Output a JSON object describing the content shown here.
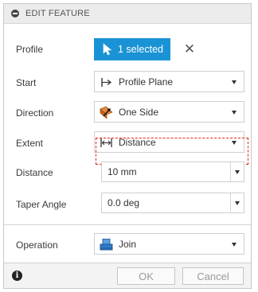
{
  "header": {
    "title": "EDIT FEATURE"
  },
  "rows": {
    "profile": {
      "label": "Profile",
      "button_text": "1 selected",
      "clear": "✕"
    },
    "start": {
      "label": "Start",
      "value": "Profile Plane"
    },
    "direction": {
      "label": "Direction",
      "value": "One Side"
    },
    "extent": {
      "label": "Extent",
      "value": "Distance"
    },
    "distance": {
      "label": "Distance",
      "value": "10 mm"
    },
    "taper": {
      "label": "Taper Angle",
      "value": "0.0 deg"
    },
    "operation": {
      "label": "Operation",
      "value": "Join"
    }
  },
  "footer": {
    "info": "i",
    "ok": "OK",
    "cancel": "Cancel"
  },
  "colors": {
    "accent": "#1a93d6",
    "highlight": "#e0201b"
  },
  "icons": {
    "select": "cursor-arrow-icon",
    "start": "profile-plane-icon",
    "direction": "one-side-icon",
    "extent": "distance-icon",
    "operation": "join-icon"
  }
}
